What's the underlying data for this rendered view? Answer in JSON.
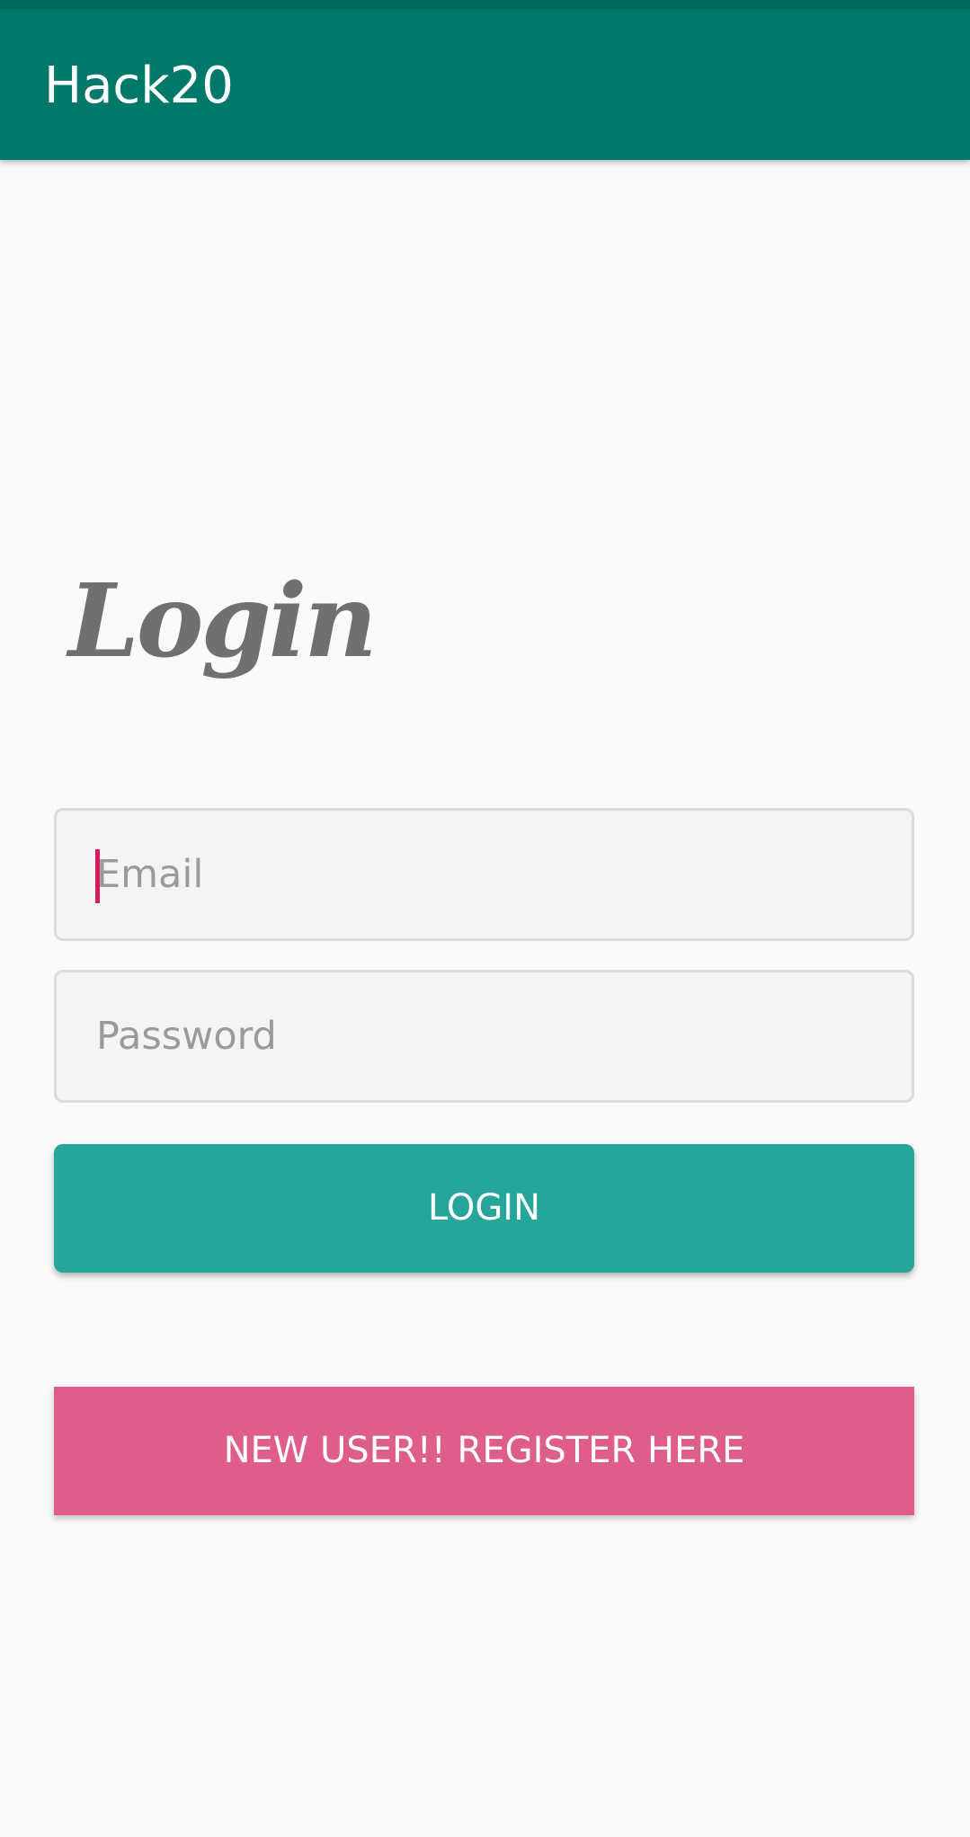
{
  "app_bar": {
    "title": "Hack20"
  },
  "login": {
    "heading": "Login",
    "email": {
      "value": "",
      "placeholder": "Email"
    },
    "password": {
      "value": "",
      "placeholder": "Password"
    },
    "login_label": "LOGIN",
    "register_label": "NEW USER!! REGISTER HERE"
  },
  "colors": {
    "status_bar": "#00695c",
    "app_bar": "#00796b",
    "login_button": "#26a69a",
    "register_button": "#de5d8b",
    "caret": "#d81b60"
  }
}
